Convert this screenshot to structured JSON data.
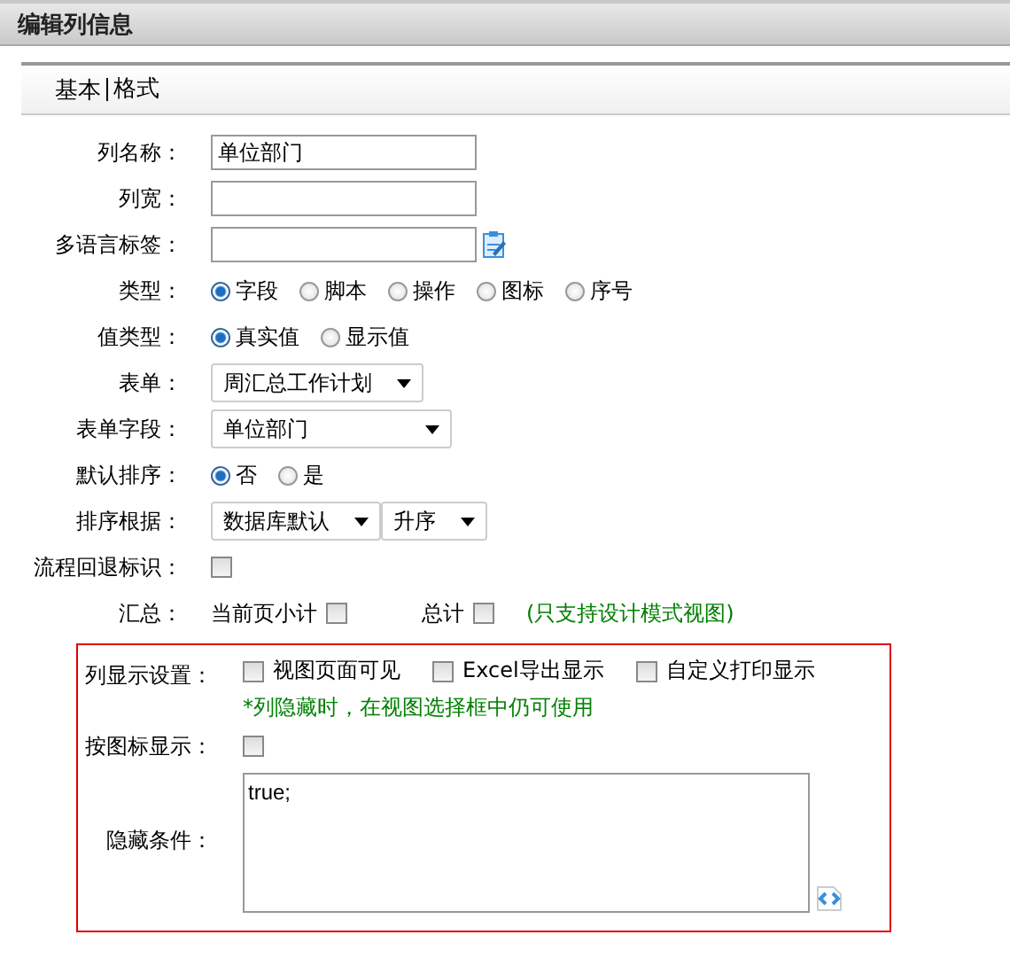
{
  "window": {
    "title": "编辑列信息"
  },
  "tabs": [
    {
      "label": "基本"
    },
    {
      "label": "格式"
    }
  ],
  "rows": [
    {
      "kind": "text",
      "label": "列名称：",
      "value": "单位部门"
    },
    {
      "kind": "text",
      "label": "列宽："
    },
    {
      "kind": "text-icon",
      "label": "多语言标签："
    },
    {
      "kind": "radio",
      "label": "类型：",
      "options": [
        {
          "label": "字段",
          "selected": true
        },
        {
          "label": "脚本",
          "selected": false
        },
        {
          "label": "操作",
          "selected": false
        },
        {
          "label": "图标",
          "selected": false
        },
        {
          "label": "序号",
          "selected": false
        }
      ]
    },
    {
      "kind": "radio",
      "label": "值类型：",
      "options": [
        {
          "label": "真实值",
          "selected": true
        },
        {
          "label": "显示值",
          "selected": false
        }
      ]
    },
    {
      "kind": "select",
      "label": "表单：",
      "selects": [
        "周汇总工作计划"
      ]
    },
    {
      "kind": "select",
      "label": "表单字段：",
      "selects": [
        "单位部门"
      ]
    },
    {
      "kind": "radio",
      "label": "默认排序：",
      "options": [
        {
          "label": "否",
          "selected": true
        },
        {
          "label": "是",
          "selected": false
        }
      ]
    },
    {
      "kind": "select",
      "label": "排序根据：",
      "selects": [
        "数据库默认",
        "升序"
      ]
    },
    {
      "kind": "checks",
      "label": "流程回退标识：",
      "checks": [
        {
          "checked": false
        }
      ]
    },
    {
      "kind": "checks",
      "label": "汇总：",
      "checks": [
        {
          "label": "当前页小计",
          "checked": false
        },
        {
          "label": "总计",
          "checked": false
        }
      ],
      "note": "(只支持设计模式视图)"
    }
  ],
  "highlighted_rows": [
    {
      "kind": "checks",
      "label": "列显示设置：",
      "checks": [
        {
          "label": "视图页面可见",
          "checked": false
        },
        {
          "label": "Excel导出显示",
          "checked": false
        },
        {
          "label": "自定义打印显示",
          "checked": false
        }
      ],
      "note": "*列隐藏时，在视图选择框中仍可使用"
    },
    {
      "kind": "checks",
      "label": "按图标显示：",
      "checks": [
        {
          "checked": false
        }
      ]
    },
    {
      "kind": "textarea",
      "label": "隐藏条件：",
      "value": "true;"
    }
  ]
}
